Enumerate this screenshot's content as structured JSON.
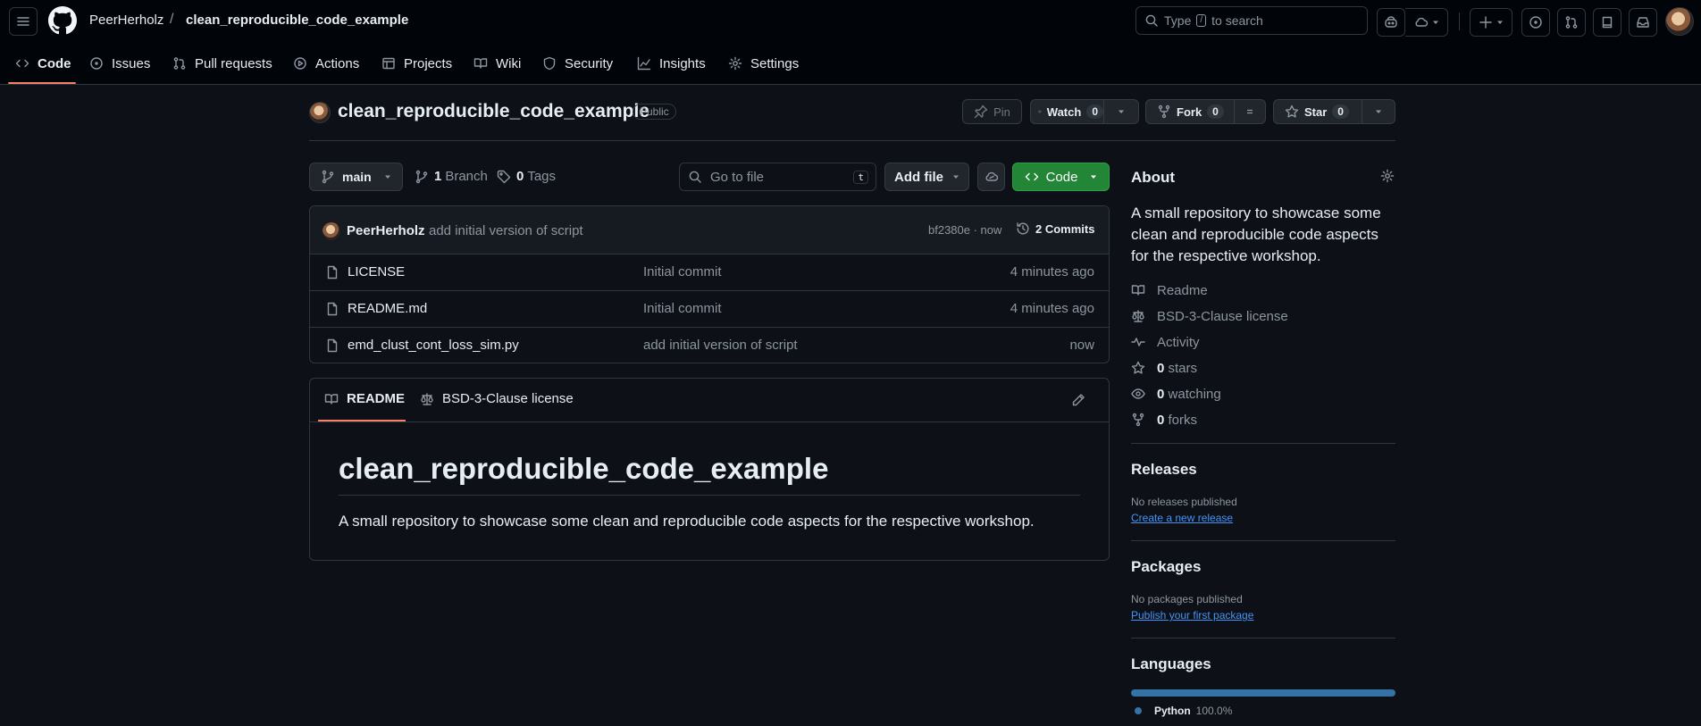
{
  "header": {
    "owner": "PeerHerholz",
    "separator": "/",
    "repo": "clean_reproducible_code_example",
    "search": {
      "prefix": "Type",
      "key": "/",
      "suffix": "to search"
    }
  },
  "repo_nav": [
    {
      "label": "Code",
      "icon": "code-icon"
    },
    {
      "label": "Issues",
      "icon": "issue-icon"
    },
    {
      "label": "Pull requests",
      "icon": "pull-request-icon"
    },
    {
      "label": "Actions",
      "icon": "play-icon"
    },
    {
      "label": "Projects",
      "icon": "table-icon"
    },
    {
      "label": "Wiki",
      "icon": "book-icon"
    },
    {
      "label": "Security",
      "icon": "shield-icon"
    },
    {
      "label": "Insights",
      "icon": "graph-icon"
    },
    {
      "label": "Settings",
      "icon": "gear-icon"
    }
  ],
  "repo_header": {
    "name": "clean_reproducible_code_example",
    "visibility": "Public",
    "pin": "Pin",
    "watch": {
      "label": "Watch",
      "count": "0"
    },
    "fork": {
      "label": "Fork",
      "count": "0"
    },
    "star": {
      "label": "Star",
      "count": "0"
    }
  },
  "toolbar": {
    "branch": "main",
    "branches_count": "1",
    "branches_label": "Branch",
    "tags_count": "0",
    "tags_label": "Tags",
    "go_to_file": "Go to file",
    "go_to_file_key": "t",
    "add_file": "Add file",
    "code": "Code"
  },
  "latest_commit": {
    "author": "PeerHerholz",
    "message": "add initial version of script",
    "sha_time": "bf2380e · now",
    "commits": "2 Commits"
  },
  "files": [
    {
      "name": "LICENSE",
      "message": "Initial commit",
      "time": "4 minutes ago"
    },
    {
      "name": "README.md",
      "message": "Initial commit",
      "time": "4 minutes ago"
    },
    {
      "name": "emd_clust_cont_loss_sim.py",
      "message": "add initial version of script",
      "time": "now"
    }
  ],
  "readme": {
    "tab_readme": "README",
    "tab_license": "BSD-3-Clause license",
    "title": "clean_reproducible_code_example",
    "body": "A small repository to showcase some clean and reproducible code aspects for the respective workshop."
  },
  "about": {
    "heading": "About",
    "description": "A small repository to showcase some clean and reproducible code aspects for the respective workshop.",
    "readme": "Readme",
    "license": "BSD-3-Clause license",
    "activity": "Activity",
    "stars_count": "0",
    "stars_label": "stars",
    "watching_count": "0",
    "watching_label": "watching",
    "forks_count": "0",
    "forks_label": "forks"
  },
  "releases": {
    "heading": "Releases",
    "text": "No releases published",
    "link": "Create a new release"
  },
  "packages": {
    "heading": "Packages",
    "text": "No packages published",
    "link": "Publish your first package"
  },
  "languages": {
    "heading": "Languages",
    "name": "Python",
    "percent": "100.0%",
    "color": "#3572A5",
    "share": 1.0
  },
  "colors": {
    "accent_green": "#238636",
    "underline": "#f78166",
    "link": "#4493f8"
  }
}
